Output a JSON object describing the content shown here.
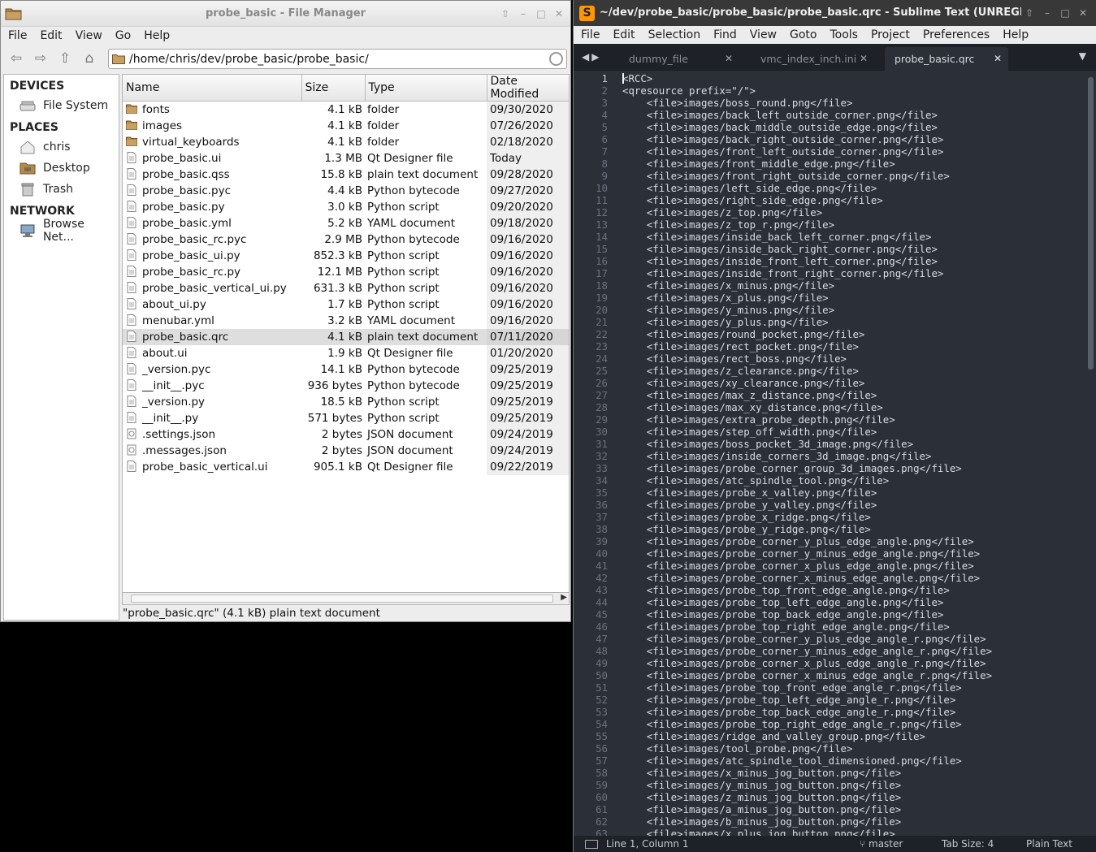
{
  "file_manager": {
    "title": "probe_basic - File Manager",
    "menu": [
      "File",
      "Edit",
      "View",
      "Go",
      "Help"
    ],
    "path": "/home/chris/dev/probe_basic/probe_basic/",
    "sidebar": {
      "devices_heading": "DEVICES",
      "devices": [
        "File System"
      ],
      "places_heading": "PLACES",
      "places": [
        "chris",
        "Desktop",
        "Trash"
      ],
      "network_heading": "NETWORK",
      "network": [
        "Browse Net..."
      ]
    },
    "columns": [
      "Name",
      "Size",
      "Type",
      "Date Modified"
    ],
    "files": [
      {
        "name": "fonts",
        "size": "4.1 kB",
        "type": "folder",
        "date": "09/30/2020",
        "kind": "folder"
      },
      {
        "name": "images",
        "size": "4.1 kB",
        "type": "folder",
        "date": "07/26/2020",
        "kind": "folder"
      },
      {
        "name": "virtual_keyboards",
        "size": "4.1 kB",
        "type": "folder",
        "date": "02/18/2020",
        "kind": "folder"
      },
      {
        "name": "probe_basic.ui",
        "size": "1.3 MB",
        "type": "Qt Designer file",
        "date": "Today",
        "kind": "file"
      },
      {
        "name": "probe_basic.qss",
        "size": "15.8 kB",
        "type": "plain text document",
        "date": "09/28/2020",
        "kind": "file"
      },
      {
        "name": "probe_basic.pyc",
        "size": "4.4 kB",
        "type": "Python bytecode",
        "date": "09/27/2020",
        "kind": "file"
      },
      {
        "name": "probe_basic.py",
        "size": "3.0 kB",
        "type": "Python script",
        "date": "09/20/2020",
        "kind": "file"
      },
      {
        "name": "probe_basic.yml",
        "size": "5.2 kB",
        "type": "YAML document",
        "date": "09/18/2020",
        "kind": "file"
      },
      {
        "name": "probe_basic_rc.pyc",
        "size": "2.9 MB",
        "type": "Python bytecode",
        "date": "09/16/2020",
        "kind": "file"
      },
      {
        "name": "probe_basic_ui.py",
        "size": "852.3 kB",
        "type": "Python script",
        "date": "09/16/2020",
        "kind": "file"
      },
      {
        "name": "probe_basic_rc.py",
        "size": "12.1 MB",
        "type": "Python script",
        "date": "09/16/2020",
        "kind": "file"
      },
      {
        "name": "probe_basic_vertical_ui.py",
        "size": "631.3 kB",
        "type": "Python script",
        "date": "09/16/2020",
        "kind": "file"
      },
      {
        "name": "about_ui.py",
        "size": "1.7 kB",
        "type": "Python script",
        "date": "09/16/2020",
        "kind": "file"
      },
      {
        "name": "menubar.yml",
        "size": "3.2 kB",
        "type": "YAML document",
        "date": "09/16/2020",
        "kind": "file"
      },
      {
        "name": "probe_basic.qrc",
        "size": "4.1 kB",
        "type": "plain text document",
        "date": "07/11/2020",
        "kind": "file",
        "selected": true
      },
      {
        "name": "about.ui",
        "size": "1.9 kB",
        "type": "Qt Designer file",
        "date": "01/20/2020",
        "kind": "file"
      },
      {
        "name": "_version.pyc",
        "size": "14.1 kB",
        "type": "Python bytecode",
        "date": "09/25/2019",
        "kind": "file"
      },
      {
        "name": "__init__.pyc",
        "size": "936 bytes",
        "type": "Python bytecode",
        "date": "09/25/2019",
        "kind": "file"
      },
      {
        "name": "_version.py",
        "size": "18.5 kB",
        "type": "Python script",
        "date": "09/25/2019",
        "kind": "file"
      },
      {
        "name": "__init__.py",
        "size": "571 bytes",
        "type": "Python script",
        "date": "09/25/2019",
        "kind": "file"
      },
      {
        "name": ".settings.json",
        "size": "2 bytes",
        "type": "JSON document",
        "date": "09/24/2019",
        "kind": "json"
      },
      {
        "name": ".messages.json",
        "size": "2 bytes",
        "type": "JSON document",
        "date": "09/24/2019",
        "kind": "json"
      },
      {
        "name": "probe_basic_vertical.ui",
        "size": "905.1 kB",
        "type": "Qt Designer file",
        "date": "09/22/2019",
        "kind": "file"
      }
    ],
    "status": "\"probe_basic.qrc\" (4.1 kB) plain text document"
  },
  "sublime": {
    "title": "~/dev/probe_basic/probe_basic/probe_basic.qrc - Sublime Text (UNREGISTER",
    "menu": [
      "File",
      "Edit",
      "Selection",
      "Find",
      "View",
      "Goto",
      "Tools",
      "Project",
      "Preferences",
      "Help"
    ],
    "tabs": [
      "dummy_file",
      "vmc_index_inch.ini",
      "probe_basic.qrc"
    ],
    "active_tab": 2,
    "lines": [
      "<RCC>",
      "<qresource prefix=\"/\">",
      "    <file>images/boss_round.png</file>",
      "    <file>images/back_left_outside_corner.png</file>",
      "    <file>images/back_middle_outside_edge.png</file>",
      "    <file>images/back_right_outside_corner.png</file>",
      "    <file>images/front_left_outside_corner.png</file>",
      "    <file>images/front_middle_edge.png</file>",
      "    <file>images/front_right_outside_corner.png</file>",
      "    <file>images/left_side_edge.png</file>",
      "    <file>images/right_side_edge.png</file>",
      "    <file>images/z_top.png</file>",
      "    <file>images/z_top_r.png</file>",
      "    <file>images/inside_back_left_corner.png</file>",
      "    <file>images/inside_back_right_corner.png</file>",
      "    <file>images/inside_front_left_corner.png</file>",
      "    <file>images/inside_front_right_corner.png</file>",
      "    <file>images/x_minus.png</file>",
      "    <file>images/x_plus.png</file>",
      "    <file>images/y_minus.png</file>",
      "    <file>images/y_plus.png</file>",
      "    <file>images/round_pocket.png</file>",
      "    <file>images/rect_pocket.png</file>",
      "    <file>images/rect_boss.png</file>",
      "    <file>images/z_clearance.png</file>",
      "    <file>images/xy_clearance.png</file>",
      "    <file>images/max_z_distance.png</file>",
      "    <file>images/max_xy_distance.png</file>",
      "    <file>images/extra_probe_depth.png</file>",
      "    <file>images/step_off_width.png</file>",
      "    <file>images/boss_pocket_3d_image.png</file>",
      "    <file>images/inside_corners_3d_image.png</file>",
      "    <file>images/probe_corner_group_3d_images.png</file>",
      "    <file>images/atc_spindle_tool.png</file>",
      "    <file>images/probe_x_valley.png</file>",
      "    <file>images/probe_y_valley.png</file>",
      "    <file>images/probe_x_ridge.png</file>",
      "    <file>images/probe_y_ridge.png</file>",
      "    <file>images/probe_corner_y_plus_edge_angle.png</file>",
      "    <file>images/probe_corner_y_minus_edge_angle.png</file>",
      "    <file>images/probe_corner_x_plus_edge_angle.png</file>",
      "    <file>images/probe_corner_x_minus_edge_angle.png</file>",
      "    <file>images/probe_top_front_edge_angle.png</file>",
      "    <file>images/probe_top_left_edge_angle.png</file>",
      "    <file>images/probe_top_back_edge_angle.png</file>",
      "    <file>images/probe_top_right_edge_angle.png</file>",
      "    <file>images/probe_corner_y_plus_edge_angle_r.png</file>",
      "    <file>images/probe_corner_y_minus_edge_angle_r.png</file>",
      "    <file>images/probe_corner_x_plus_edge_angle_r.png</file>",
      "    <file>images/probe_corner_x_minus_edge_angle_r.png</file>",
      "    <file>images/probe_top_front_edge_angle_r.png</file>",
      "    <file>images/probe_top_left_edge_angle_r.png</file>",
      "    <file>images/probe_top_back_edge_angle_r.png</file>",
      "    <file>images/probe_top_right_edge_angle_r.png</file>",
      "    <file>images/ridge_and_valley_group.png</file>",
      "    <file>images/tool_probe.png</file>",
      "    <file>images/atc_spindle_tool_dimensioned.png</file>",
      "    <file>images/x_minus_jog_button.png</file>",
      "    <file>images/y_minus_jog_button.png</file>",
      "    <file>images/z_minus_jog_button.png</file>",
      "    <file>images/a_minus_jog_button.png</file>",
      "    <file>images/b_minus_jog_button.png</file>",
      "    <file>images/x_plus_jog_button.png</file>"
    ],
    "status": {
      "position": "Line 1, Column 1",
      "branch": "master",
      "tab_size": "Tab Size: 4",
      "syntax": "Plain Text"
    },
    "colors": {
      "background": "#2b3038",
      "tabbar": "#1e2127",
      "accent": "#ff9800"
    }
  }
}
